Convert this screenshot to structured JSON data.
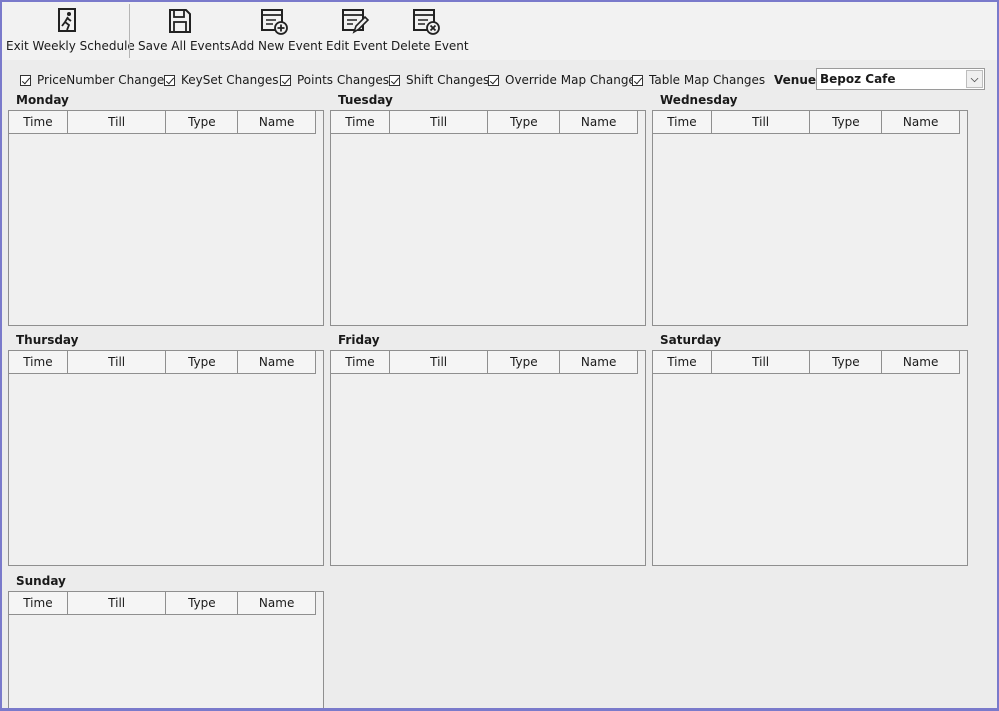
{
  "toolbar": {
    "buttons": [
      {
        "label": "Exit Weekly Schedule",
        "icon": "exit-run-icon"
      },
      {
        "label": "Save All Events",
        "icon": "save-icon"
      },
      {
        "label": "Add New Event",
        "icon": "add-event-icon"
      },
      {
        "label": "Edit Event",
        "icon": "edit-event-icon"
      },
      {
        "label": "Delete Event",
        "icon": "delete-event-icon"
      }
    ]
  },
  "filters": {
    "checkboxes": [
      {
        "label": "PriceNumber Changes",
        "checked": true
      },
      {
        "label": "KeySet Changes",
        "checked": true
      },
      {
        "label": "Points Changes",
        "checked": true
      },
      {
        "label": "Shift Changes",
        "checked": true
      },
      {
        "label": "Override Map Changes",
        "checked": true
      },
      {
        "label": "Table Map Changes",
        "checked": true
      }
    ],
    "venue_label": "Venue:",
    "venue_value": "Bepoz Cafe"
  },
  "columns": [
    "Time",
    "Till",
    "Type",
    "Name"
  ],
  "days": [
    {
      "name": "Monday"
    },
    {
      "name": "Tuesday"
    },
    {
      "name": "Wednesday"
    },
    {
      "name": "Thursday"
    },
    {
      "name": "Friday"
    },
    {
      "name": "Saturday"
    },
    {
      "name": "Sunday"
    }
  ],
  "colors": {
    "frame": "#7a7acb",
    "background": "#ececec",
    "panel": "#f0f0f0"
  }
}
